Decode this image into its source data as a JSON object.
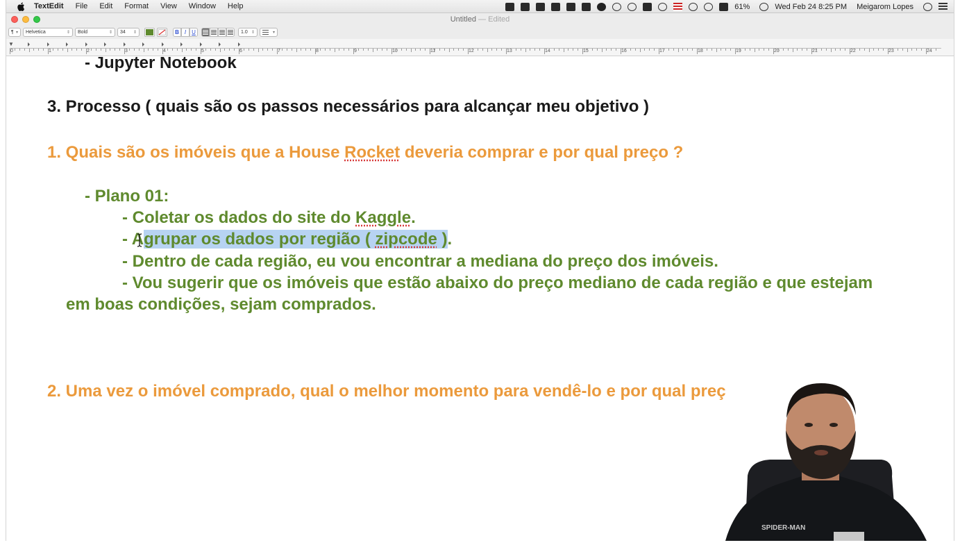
{
  "menubar": {
    "app_name": "TextEdit",
    "items": [
      "File",
      "Edit",
      "Format",
      "View",
      "Window",
      "Help"
    ],
    "battery": "61%",
    "datetime": "Wed Feb 24  8:25 PM",
    "user": "Meigarom Lopes"
  },
  "window": {
    "title": "Untitled",
    "status": "— Edited"
  },
  "toolbar": {
    "paragraph_style": "¶",
    "font_family": "Helvetica",
    "font_style": "Bold",
    "font_size": "34",
    "bold_label": "B",
    "italic_label": "I",
    "underline_label": "U",
    "line_spacing": "1.0",
    "text_color": "#5f8a2e"
  },
  "ruler": {
    "labels": [
      "0",
      "1",
      "2",
      "3",
      "4",
      "5",
      "6",
      "7",
      "8",
      "9",
      "10",
      "11",
      "12",
      "13",
      "14",
      "15",
      "16",
      "17",
      "18",
      "19",
      "20",
      "21",
      "22",
      "23",
      "24"
    ]
  },
  "document": {
    "line1": "- Jupyter Notebook",
    "heading3": "3. Processo ( quais são os passos necessários para alcançar meu objetivo )",
    "q1_pre": "1. Quais são os imóveis que a House ",
    "q1_word": "Rocket",
    "q1_post": " deveria comprar e por qual preço ?",
    "plan_label": "- Plano 01:",
    "step1_pre": "- Coletar os dados do site do ",
    "step1_word": "Kaggle",
    "step1_post": ".",
    "step2_lead": "- A",
    "step2_sel_a": "grupar os dados por região ( ",
    "step2_sel_word": "zipcode",
    "step2_sel_b": " )",
    "step2_post": ".",
    "step3": "- Dentro de cada região, eu vou encontrar a mediana do preço dos imóveis.",
    "step4_line1": "- Vou sugerir que os imóveis que estão abaixo do preço mediano de cada região e que estejam",
    "step4_line2": "em boas condições, sejam comprados.",
    "q2": "2. Uma vez o imóvel comprado, qual o melhor momento para vendê-lo e por qual preç"
  },
  "colors": {
    "heading": "#1a1a1a",
    "question": "#eb9a3c",
    "plan": "#5f8a2e",
    "selection": "#b7d3f2"
  },
  "webcam": {
    "shirt_text": "SPIDER-MAN"
  }
}
